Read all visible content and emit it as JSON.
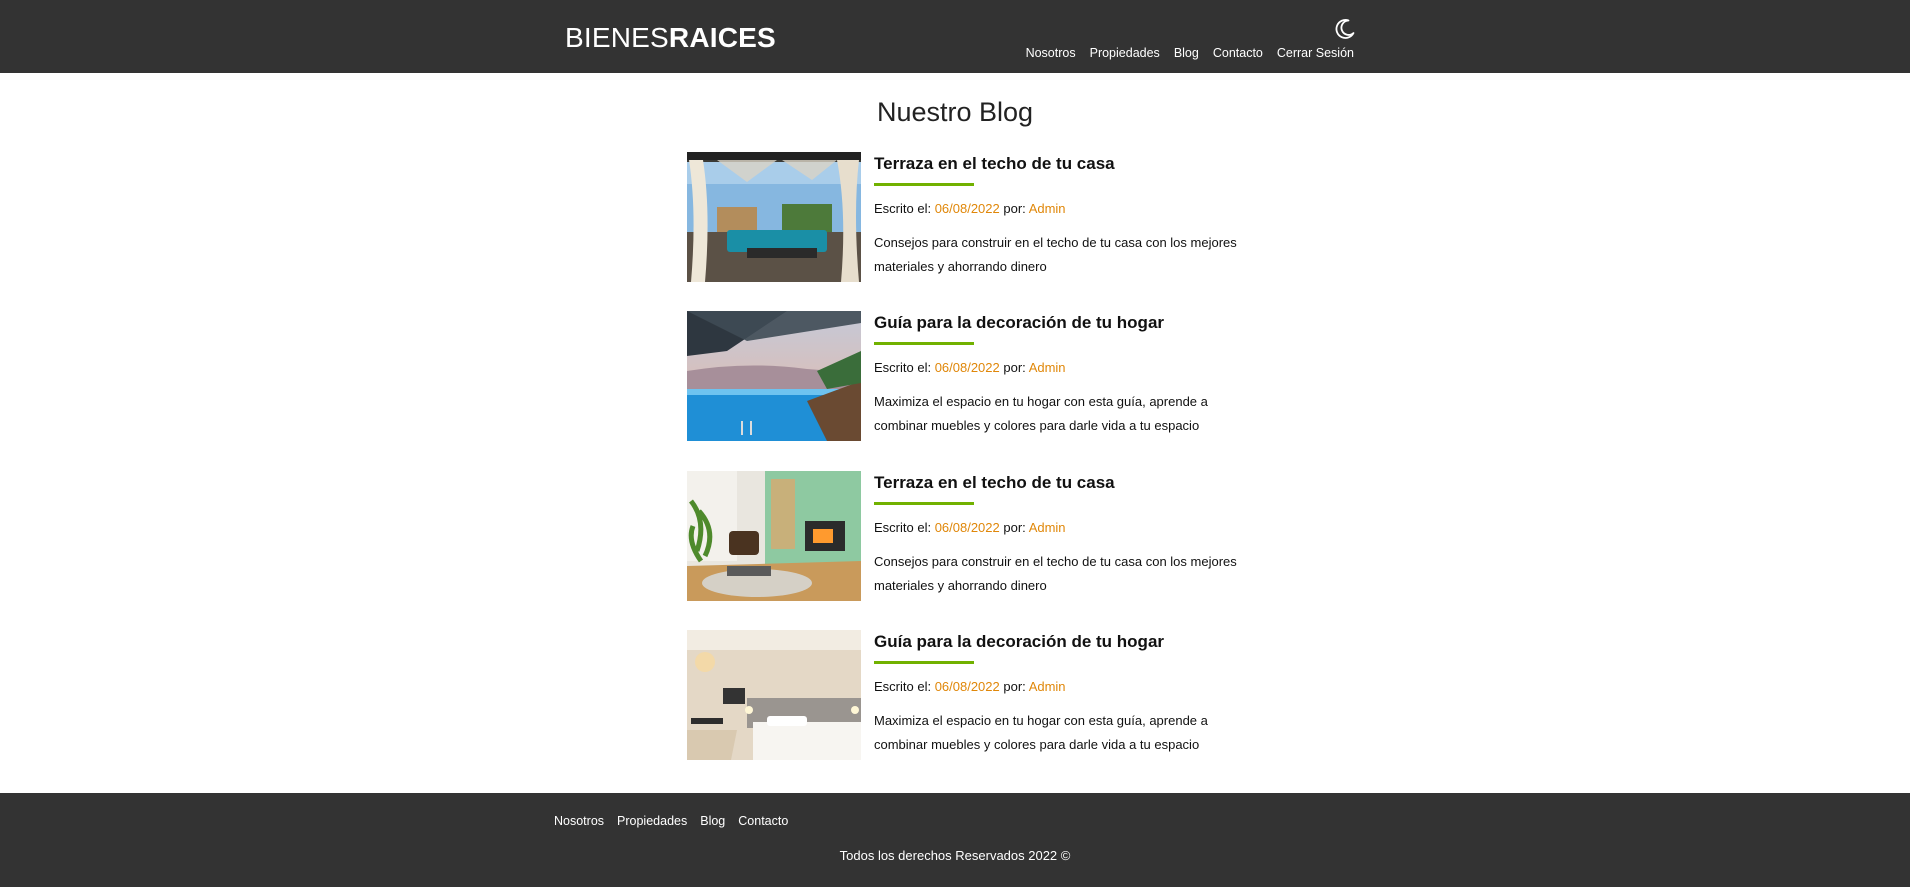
{
  "header": {
    "logo_light": "BIENES",
    "logo_bold": "RAICES",
    "dark_mode_icon": "moon-icon",
    "nav": [
      "Nosotros",
      "Propiedades",
      "Blog",
      "Contacto",
      "Cerrar Sesión"
    ]
  },
  "main": {
    "title": "Nuestro Blog",
    "entries": [
      {
        "title": "Terraza en el techo de tu casa",
        "meta_prefix": "Escrito el: ",
        "date": "06/08/2022",
        "by": " por: ",
        "author": "Admin",
        "description": "Consejos para construir en el techo de tu casa con los mejores materiales y ahorrando dinero",
        "image": "rooftop-terrace-photo"
      },
      {
        "title": "Guía para la decoración de tu hogar",
        "meta_prefix": "Escrito el: ",
        "date": "06/08/2022",
        "by": " por: ",
        "author": "Admin",
        "description": "Maximiza el espacio en tu hogar con esta guía, aprende a combinar muebles y colores para darle vida a tu espacio",
        "image": "infinity-pool-photo"
      },
      {
        "title": "Terraza en el techo de tu casa",
        "meta_prefix": "Escrito el: ",
        "date": "06/08/2022",
        "by": " por: ",
        "author": "Admin",
        "description": "Consejos para construir en el techo de tu casa con los mejores materiales y ahorrando dinero",
        "image": "living-room-photo"
      },
      {
        "title": "Guía para la decoración de tu hogar",
        "meta_prefix": "Escrito el: ",
        "date": "06/08/2022",
        "by": " por: ",
        "author": "Admin",
        "description": "Maximiza el espacio en tu hogar con esta guía, aprende a combinar muebles y colores para darle vida a tu espacio",
        "image": "bedroom-photo"
      }
    ]
  },
  "footer": {
    "nav": [
      "Nosotros",
      "Propiedades",
      "Blog",
      "Contacto"
    ],
    "copyright": "Todos los derechos Reservados 2022 ©"
  },
  "colors": {
    "header_bg": "#333333",
    "accent_green": "#71b100",
    "accent_orange": "#e08709"
  }
}
